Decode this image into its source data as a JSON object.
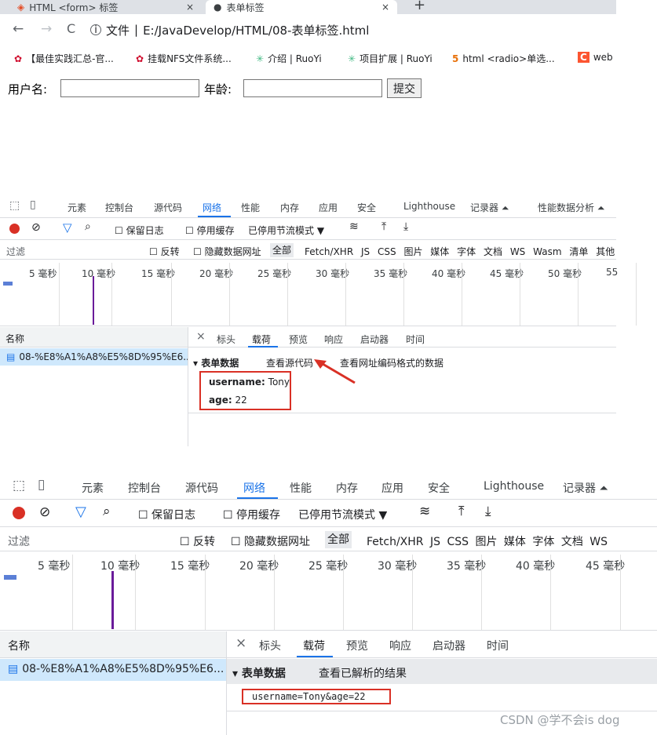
{
  "browser": {
    "tabs": [
      {
        "title": "HTML <form> 标签"
      },
      {
        "title": "表单标签"
      }
    ],
    "nav": {
      "back": "←",
      "forward": "→",
      "reload": "C"
    },
    "address": {
      "prefix": "文件",
      "separator": "|",
      "url": "E:/JavaDevelop/HTML/08-表单标签.html"
    },
    "bookmarks": [
      "【最佳实践汇总-官...",
      "挂载NFS文件系统...",
      "介绍 | RuoYi",
      "项目扩展 | RuoYi",
      "html <radio>单选...",
      "web"
    ]
  },
  "form": {
    "username_label": "用户名:",
    "age_label": "年龄:",
    "submit_label": "提交",
    "username_value": "",
    "age_value": ""
  },
  "devtools": {
    "tabs": [
      "元素",
      "控制台",
      "源代码",
      "网络",
      "性能",
      "内存",
      "应用",
      "安全",
      "Lighthouse",
      "记录器 ⏶",
      "性能数据分析 ⏶"
    ],
    "toolbar": {
      "preserve_log": "保留日志",
      "disable_cache": "停用缓存",
      "throttling": "已停用节流模式"
    },
    "filter": {
      "placeholder": "过滤",
      "invert": "反转",
      "hide_data_urls": "隐藏数据网址",
      "all": "全部",
      "types": [
        "Fetch/XHR",
        "JS",
        "CSS",
        "图片",
        "媒体",
        "字体",
        "文档",
        "WS",
        "Wasm",
        "清单",
        "其他"
      ]
    },
    "timeline_ticks": [
      "5 毫秒",
      "10 毫秒",
      "15 毫秒",
      "20 毫秒",
      "25 毫秒",
      "30 毫秒",
      "35 毫秒",
      "40 毫秒",
      "45 毫秒",
      "50 毫秒",
      "55"
    ],
    "name_header": "名称",
    "request_name": "08-%E8%A1%A8%E5%8D%95%E6...",
    "detail_tabs": [
      "标头",
      "载荷",
      "预览",
      "响应",
      "启动器",
      "时间"
    ],
    "close": "×",
    "section_title": "表单数据",
    "view_source": "查看源代码",
    "view_url_encoded": "查看网址编码格式的数据",
    "view_parsed": "查看已解析的结果",
    "payload": [
      {
        "key": "username:",
        "value": "Tony"
      },
      {
        "key": "age:",
        "value": "22"
      }
    ],
    "raw_payload": "username=Tony&age=22"
  },
  "watermark": "CSDN @学不会is dog",
  "colors": {
    "accent": "#1a73e8",
    "highlight": "#d93025",
    "record": "#d93025",
    "timeline_bar": "#6a1b9a"
  }
}
